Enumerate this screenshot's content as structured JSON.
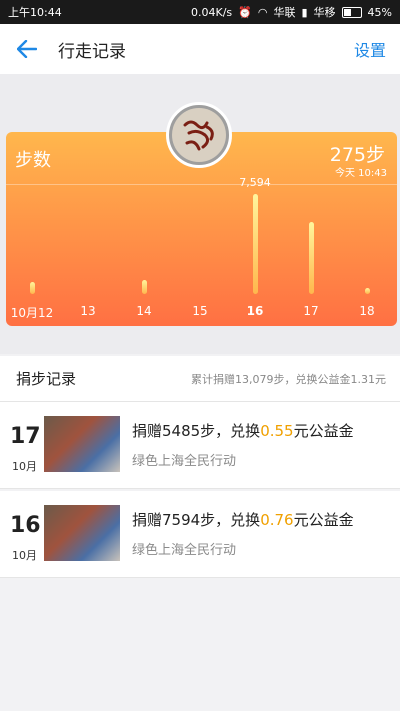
{
  "statusbar": {
    "time": "上午10:44",
    "speed": "0.04K/s",
    "carrier1": "华联",
    "carrier2": "华移",
    "battery": "45%"
  },
  "appbar": {
    "title": "行走记录",
    "settings_label": "设置"
  },
  "card": {
    "label": "步数",
    "today_steps": "275步",
    "today_time": "今天 10:43",
    "peak_label": "7,594",
    "days": [
      "10月12",
      "13",
      "14",
      "15",
      "16",
      "17",
      "18"
    ],
    "active_day": "16"
  },
  "chart_data": {
    "type": "bar",
    "categories": [
      "10月12",
      "13",
      "14",
      "15",
      "16",
      "17",
      "18"
    ],
    "values": [
      900,
      0,
      1050,
      0,
      7594,
      5485,
      275
    ],
    "annotations": [
      "7,594"
    ]
  },
  "records_section": {
    "title": "捐步记录",
    "summary": "累计捐赠13,079步，兑换公益金1.31元"
  },
  "records": [
    {
      "day": "17",
      "month": "10月",
      "text_pre": "捐赠5485步，兑换",
      "amount": "0.55",
      "text_post": "元公益金",
      "campaign": "绿色上海全民行动"
    },
    {
      "day": "16",
      "month": "10月",
      "text_pre": "捐赠7594步，兑换",
      "amount": "0.76",
      "text_post": "元公益金",
      "campaign": "绿色上海全民行动"
    }
  ]
}
